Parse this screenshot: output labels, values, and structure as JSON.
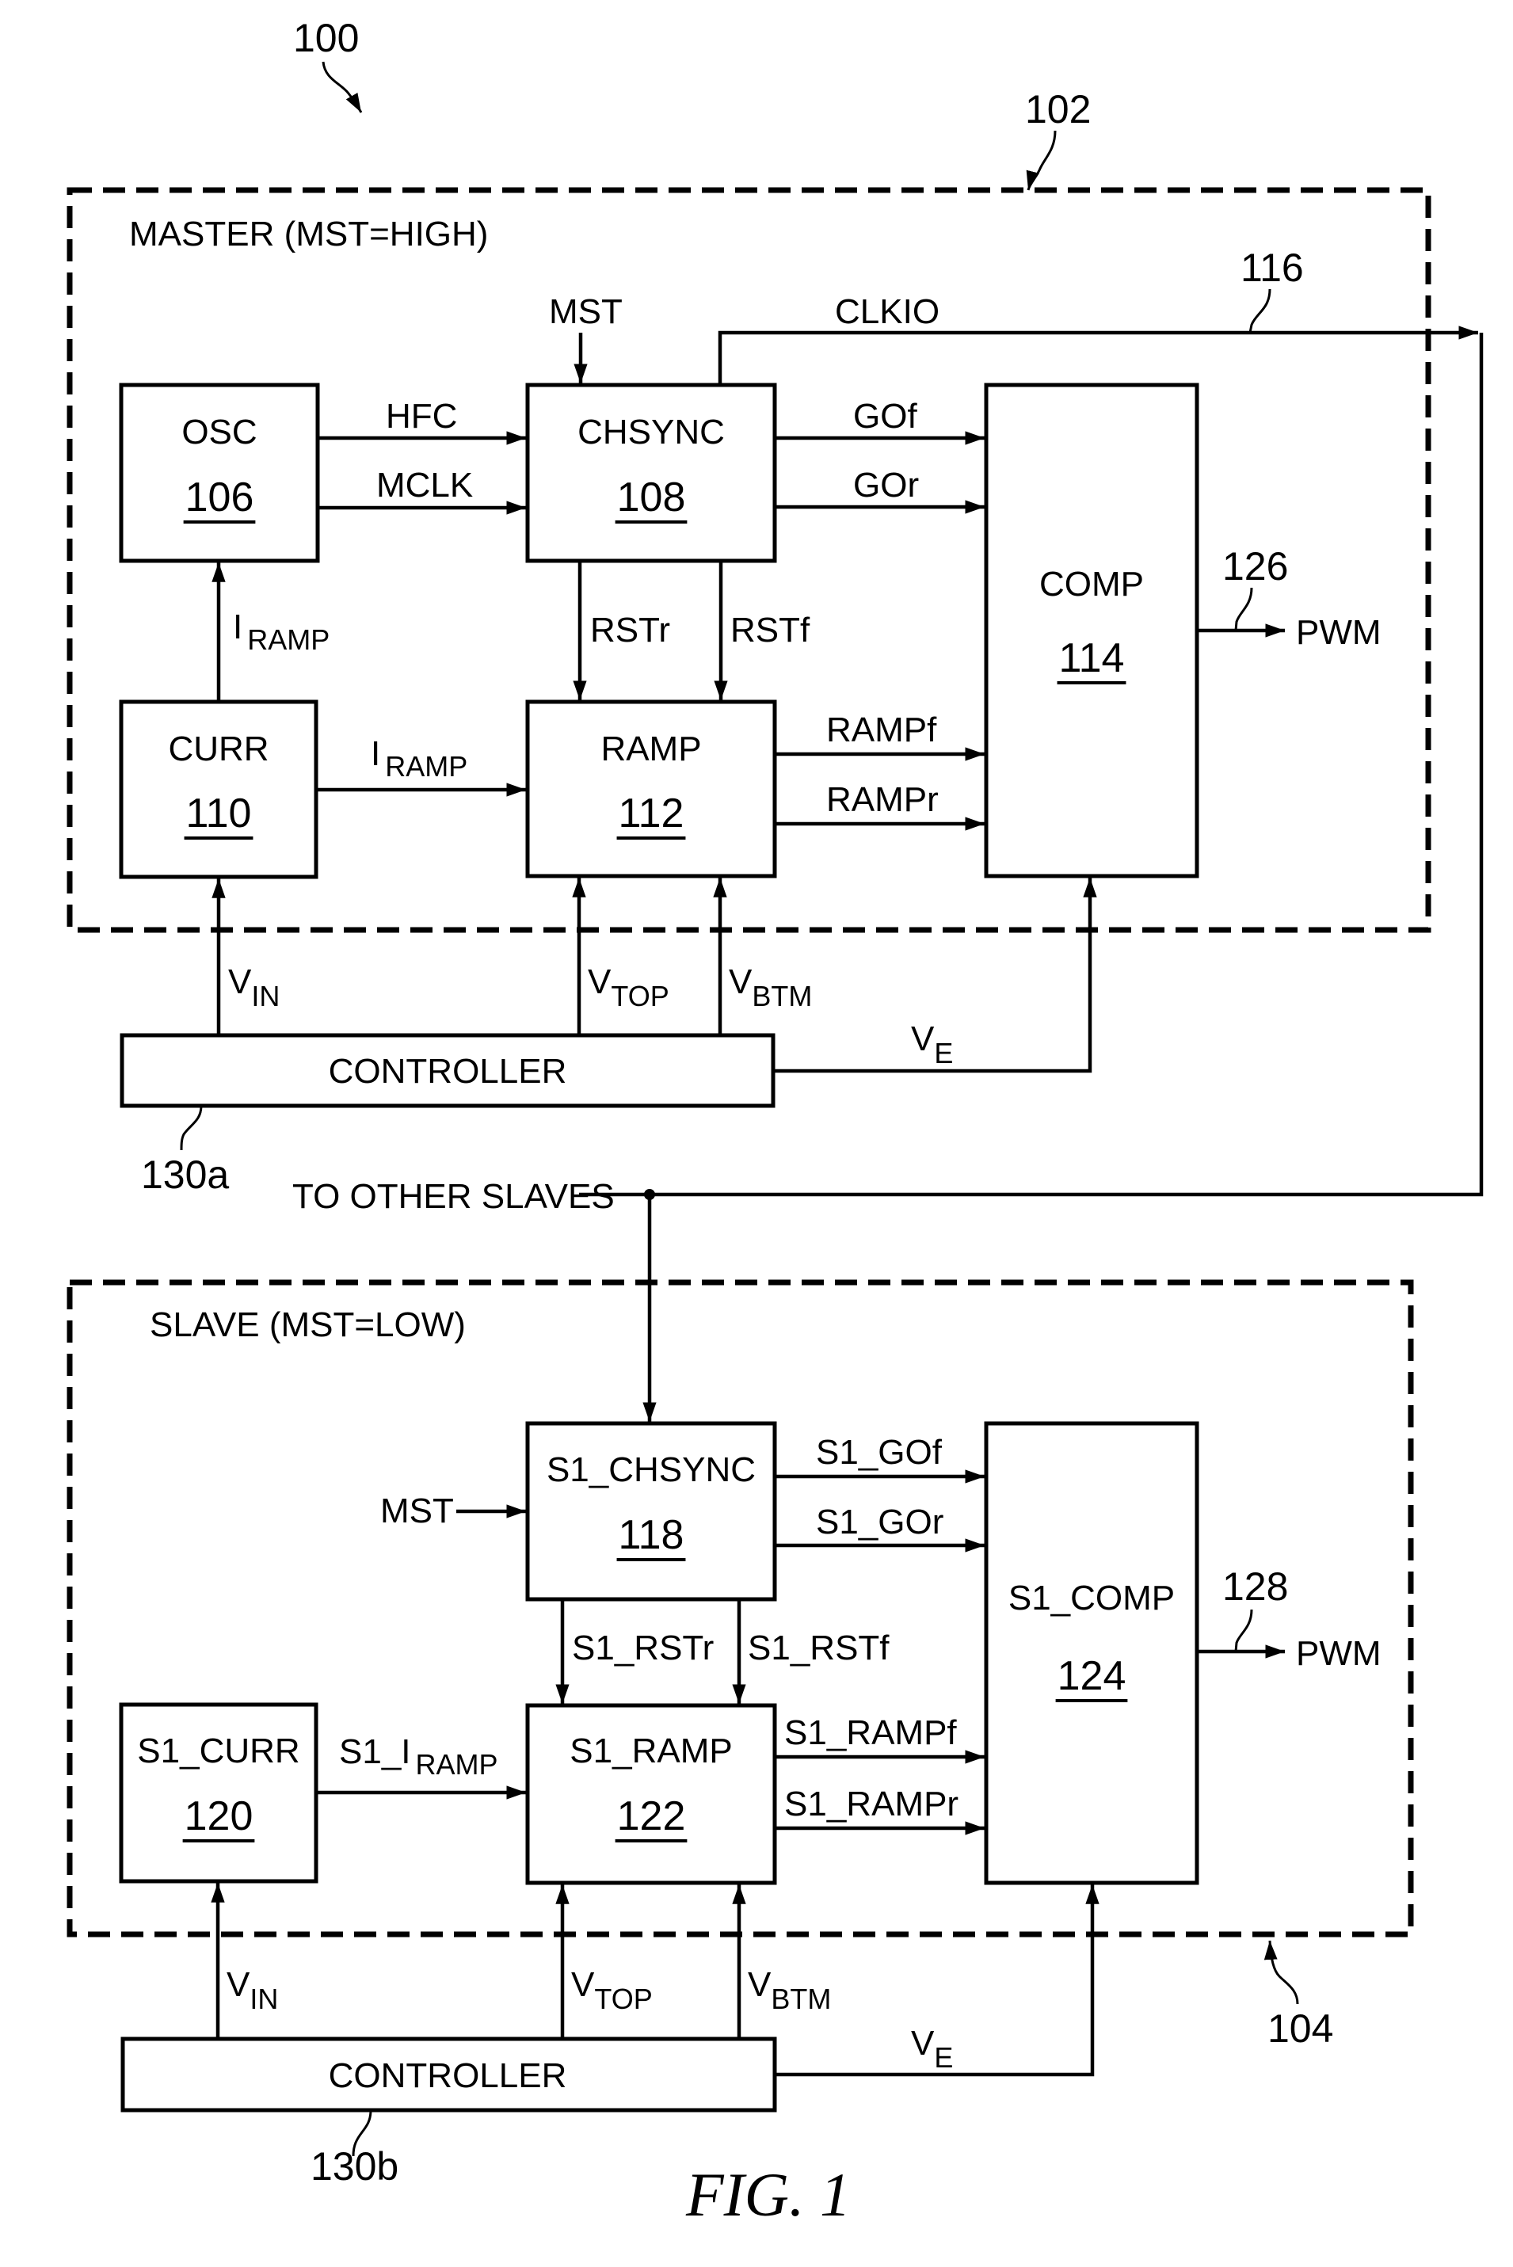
{
  "figure": {
    "caption": "FIG. 1",
    "ref_system": "100",
    "ref_master": "102",
    "ref_slave": "104"
  },
  "master": {
    "title": "MASTER (MST=HIGH)",
    "mst_input": "MST",
    "clkio_label": "CLKIO",
    "clkio_ref": "116",
    "pwm_ref": "126",
    "pwm_label": "PWM",
    "blocks": {
      "osc": {
        "name": "OSC",
        "num": "106"
      },
      "chsync": {
        "name": "CHSYNC",
        "num": "108"
      },
      "curr": {
        "name": "CURR",
        "num": "110"
      },
      "ramp": {
        "name": "RAMP",
        "num": "112"
      },
      "comp": {
        "name": "COMP",
        "num": "114"
      },
      "controller": {
        "name": "CONTROLLER",
        "ref": "130a"
      }
    },
    "signals": {
      "hfc": "HFC",
      "mclk": "MCLK",
      "gof": "GOf",
      "gor": "GOr",
      "rstr": "RSTr",
      "rstf": "RSTf",
      "rampf": "RAMPf",
      "rampr": "RAMPr",
      "iramp_main": "I",
      "iramp_sub": "RAMP",
      "vin_main": "V",
      "vin_sub": "IN",
      "vtop_main": "V",
      "vtop_sub": "TOP",
      "vbtm_main": "V",
      "vbtm_sub": "BTM",
      "ve_main": "V",
      "ve_sub": "E"
    }
  },
  "link": {
    "to_other_slaves": "TO OTHER SLAVES"
  },
  "slave": {
    "title": "SLAVE (MST=LOW)",
    "mst_input": "MST",
    "pwm_ref": "128",
    "pwm_label": "PWM",
    "blocks": {
      "chsync": {
        "name": "S1_CHSYNC",
        "num": "118"
      },
      "curr": {
        "name": "S1_CURR",
        "num": "120"
      },
      "ramp": {
        "name": "S1_RAMP",
        "num": "122"
      },
      "comp": {
        "name": "S1_COMP",
        "num": "124"
      },
      "controller": {
        "name": "CONTROLLER",
        "ref": "130b"
      }
    },
    "signals": {
      "gof": "S1_GOf",
      "gor": "S1_GOr",
      "rstr": "S1_RSTr",
      "rstf": "S1_RSTf",
      "rampf": "S1_RAMPf",
      "rampr": "S1_RAMPr",
      "iramp_main": "S1_I",
      "iramp_sub": "RAMP",
      "vin_main": "V",
      "vin_sub": "IN",
      "vtop_main": "V",
      "vtop_sub": "TOP",
      "vbtm_main": "V",
      "vbtm_sub": "BTM",
      "ve_main": "V",
      "ve_sub": "E"
    }
  }
}
